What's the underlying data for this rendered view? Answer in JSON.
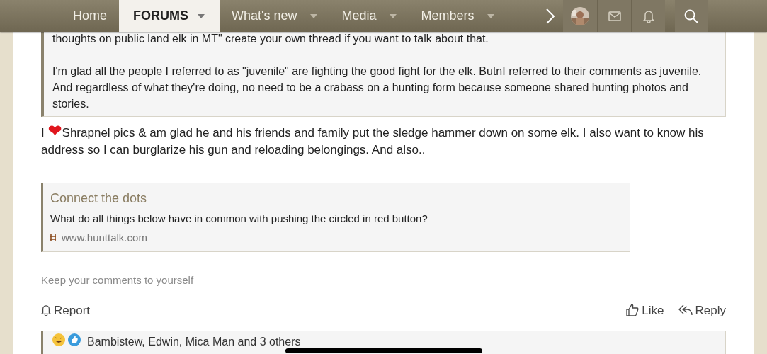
{
  "nav": {
    "tabs": [
      {
        "label": "Home",
        "selected": false,
        "dropdown": false
      },
      {
        "label": "FORUMS",
        "selected": true,
        "dropdown": true
      },
      {
        "label": "What's new",
        "selected": false,
        "dropdown": true
      },
      {
        "label": "Media",
        "selected": false,
        "dropdown": true
      },
      {
        "label": "Members",
        "selected": false,
        "dropdown": true
      }
    ]
  },
  "quote": {
    "paragraphs": [
      "thoughts on public land elk in MT\" create your own thread if you want to talk about that.",
      "I'm glad all the people I referred to as \"juvenile\" are fighting the good fight for the elk. ButnI referred to their comments as juvenile. And regardless of what they're doing, no need to be a crabass on a hunting form because someone shared hunting photos and stories."
    ]
  },
  "message": {
    "before": "I ",
    "heart": "❤",
    "after": "Shrapnel pics & am glad he and his friends and family put the sledge hammer down on some elk. I also want to know his address so I can burglarize his gun and reloading belongings. And also.."
  },
  "link_preview": {
    "title": "Connect the dots",
    "description": "What do all things below have in common with pushing the circled in red button?",
    "site": "www.hunttalk.com"
  },
  "signature": "Keep your comments to yourself",
  "actions": {
    "left": [
      "Report"
    ],
    "right": [
      "Like",
      "Reply"
    ]
  },
  "reactions": {
    "text": "Bambistew, Edwin, Mica Man and 3 others"
  }
}
